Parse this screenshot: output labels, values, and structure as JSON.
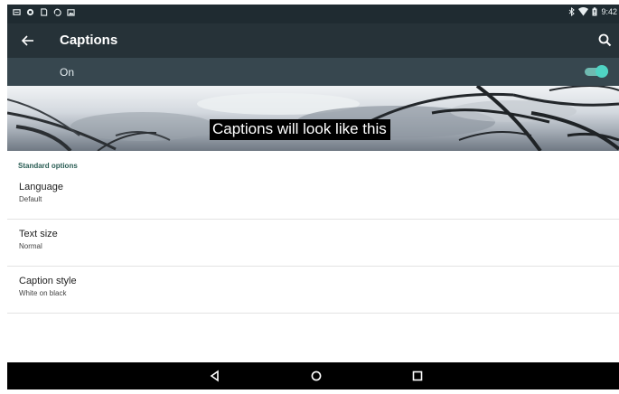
{
  "status_bar": {
    "left_icons": [
      "notification-icon",
      "record-icon",
      "sd-card-icon",
      "sync-icon",
      "photo-icon"
    ],
    "right_icons": [
      "bluetooth-icon",
      "wifi-icon",
      "battery-icon"
    ],
    "time": "9:42"
  },
  "toolbar": {
    "title": "Captions",
    "back_icon": "arrow-back-icon",
    "search_icon": "search-icon"
  },
  "master_switch": {
    "label": "On",
    "enabled": true
  },
  "preview": {
    "caption_text": "Captions will look like this"
  },
  "settings": {
    "section_header": "Standard options",
    "items": [
      {
        "title": "Language",
        "summary": "Default"
      },
      {
        "title": "Text size",
        "summary": "Normal"
      },
      {
        "title": "Caption style",
        "summary": "White on black"
      }
    ]
  },
  "nav_bar": {
    "buttons": [
      "back-triangle-icon",
      "home-circle-icon",
      "recents-square-icon"
    ]
  },
  "colors": {
    "status_bar": "#1f2b31",
    "toolbar": "#263238",
    "switch_bar": "#37474f",
    "accent": "#4fd3c3",
    "section_header": "#2a5d54"
  }
}
